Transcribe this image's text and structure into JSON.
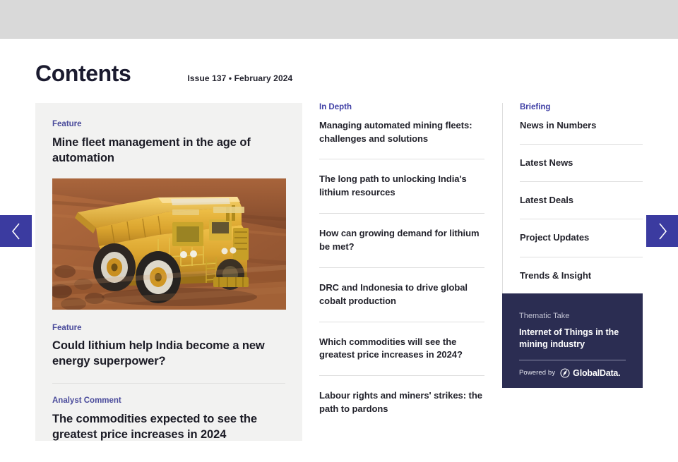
{
  "header": {
    "title": "Contents",
    "issue_line": "Issue 137 • February 2024"
  },
  "nav": {
    "prev_label": "Previous page",
    "next_label": "Next page",
    "accent_color": "#3b3ba0"
  },
  "feature_card": {
    "background_color": "#f2f2f1",
    "blocks": [
      {
        "kicker": "Feature",
        "headline": "Mine fleet management in the age of automation",
        "has_image": true,
        "image_alt": "Yellow Komatsu mining haul truck driving on a red dirt mine road"
      },
      {
        "kicker": "Feature",
        "headline": "Could lithium help India become a new energy superpower?",
        "has_image": false
      },
      {
        "kicker": "Analyst Comment",
        "headline": "The commodities expected to see the greatest price increases in 2024",
        "has_image": false
      }
    ]
  },
  "in_depth": {
    "kicker": "In Depth",
    "kicker_color": "#3f3fa5",
    "items": [
      "Managing automated mining fleets: challenges and solutions",
      "The long path to unlocking India's lithium resources",
      "How can growing demand for lithium be met?",
      "DRC and Indonesia to drive global cobalt production",
      "Which commodities will see the greatest price increases in 2024?",
      "Labour rights and miners' strikes: the path to pardons"
    ]
  },
  "briefing": {
    "kicker": "Briefing",
    "kicker_color": "#3f3fa5",
    "items": [
      "News in Numbers",
      "Latest News",
      "Latest Deals",
      "Project Updates",
      "Trends & Insight"
    ]
  },
  "thematic_take": {
    "kicker": "Thematic Take",
    "title": "Internet of Things in the mining industry",
    "powered_by_label": "Powered by",
    "brand_name": "GlobalData.",
    "background_color": "#2b2d52"
  }
}
